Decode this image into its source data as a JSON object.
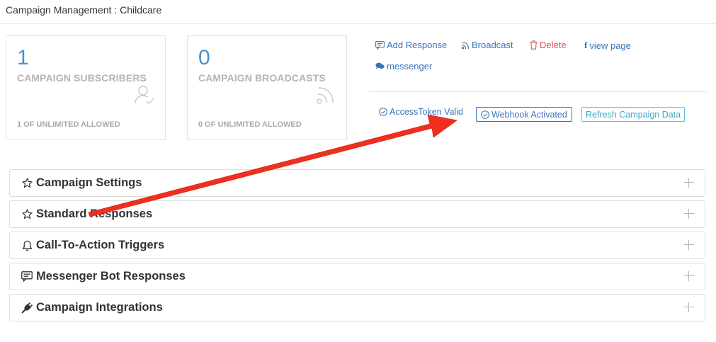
{
  "page": {
    "title": "Campaign Management : Childcare"
  },
  "stats": [
    {
      "value": "1",
      "label": "CAMPAIGN SUBSCRIBERS",
      "footer": "1 OF UNLIMITED ALLOWED",
      "icon": "user-check-icon"
    },
    {
      "value": "0",
      "label": "CAMPAIGN BROADCASTS",
      "footer": "0 OF UNLIMITED ALLOWED",
      "icon": "rss-icon"
    }
  ],
  "actions": {
    "add_response": "Add Response",
    "broadcast": "Broadcast",
    "delete": "Delete",
    "view_page": "view page",
    "messenger": "messenger"
  },
  "status": {
    "token": "AccessToken Valid",
    "webhook": "Webhook Activated",
    "refresh": "Refresh Campaign Data"
  },
  "panels": [
    {
      "title": "Campaign Settings",
      "icon": "star-icon"
    },
    {
      "title": "Standard Responses",
      "icon": "star-icon"
    },
    {
      "title": "Call-To-Action Triggers",
      "icon": "bell-icon"
    },
    {
      "title": "Messenger Bot Responses",
      "icon": "comment-icon"
    },
    {
      "title": "Campaign Integrations",
      "icon": "plug-icon"
    }
  ],
  "colors": {
    "accent_blue": "#3a73b8",
    "stat_number": "#4a8fd4",
    "danger": "#d9534f",
    "info": "#5bc0de",
    "annotation_arrow": "#f0301f"
  }
}
